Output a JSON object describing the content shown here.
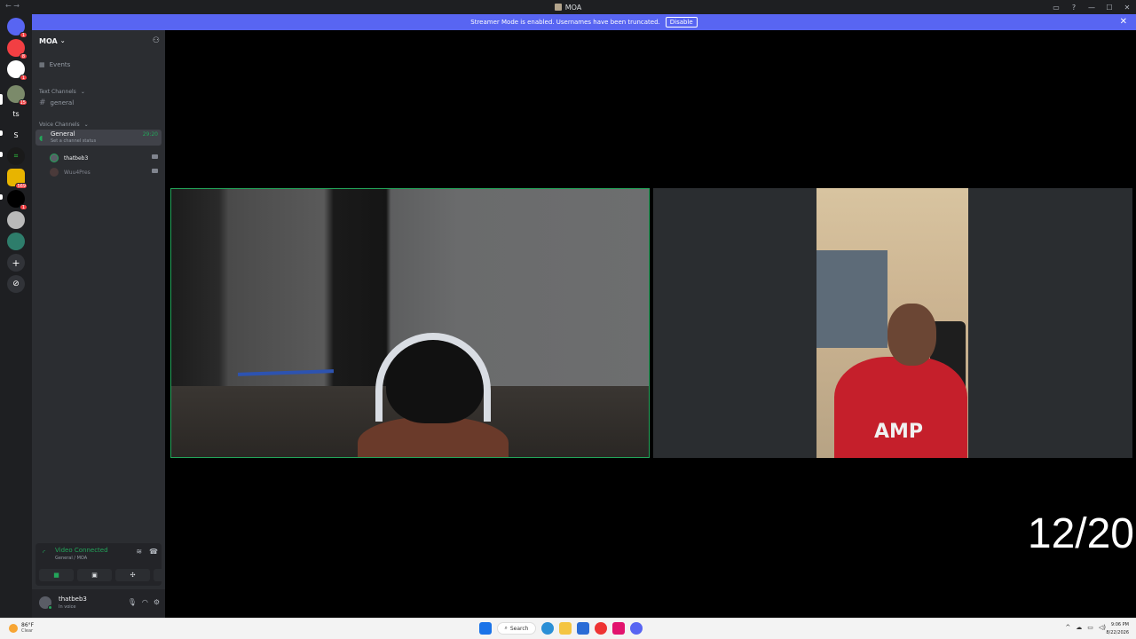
{
  "window": {
    "title": "MOA",
    "nav_arrows": "← →",
    "controls": [
      "▭",
      "?",
      "—",
      "☐",
      "✕"
    ]
  },
  "banner": {
    "message": "Streamer Mode is enabled. Usernames have been truncated.",
    "disable_label": "Disable",
    "close_icon": "✕"
  },
  "guilds": [
    {
      "label": "",
      "color": "#5865f2",
      "icon": "discord-home-icon",
      "badge": "1"
    },
    {
      "label": "",
      "color": "#f23f43",
      "icon": "server-icon",
      "badge": "8"
    },
    {
      "label": "",
      "color": "#ffffff",
      "icon": "server-icon",
      "badge": "1"
    },
    {
      "label": "",
      "color": "#7b8a6a",
      "icon": "server-icon",
      "badge": "15"
    },
    {
      "label": "ts",
      "color": "#1e1f22",
      "icon": "text-server-icon",
      "badge": ""
    },
    {
      "label": "S",
      "color": "#1e1f22",
      "icon": "text-server-icon",
      "badge": ""
    },
    {
      "label": "",
      "color": "#1a1a1a",
      "icon": "server-icon",
      "badge": ""
    },
    {
      "label": "",
      "color": "#e8b400",
      "icon": "server-icon",
      "badge": "569"
    },
    {
      "label": "",
      "color": "#000000",
      "icon": "server-icon",
      "badge": "1"
    },
    {
      "label": "",
      "color": "#b9b9b9",
      "icon": "server-icon",
      "badge": ""
    },
    {
      "label": "",
      "color": "#2e7d6b",
      "icon": "server-icon",
      "badge": ""
    },
    {
      "label": "+",
      "color": "#313338",
      "icon": "add-server-icon",
      "badge": ""
    },
    {
      "label": "⊘",
      "color": "#313338",
      "icon": "explore-icon",
      "badge": ""
    }
  ],
  "sidebar": {
    "server_name": "MOA",
    "server_chevron": "⌄",
    "events_label": "Events",
    "text_category": "Text Channels",
    "text_channels": [
      "general"
    ],
    "voice_category": "Voice Channels",
    "voice_channel": {
      "name": "General",
      "status_prompt": "Set a channel status",
      "timer": "29:20"
    },
    "members": [
      {
        "name": "thatbeb3",
        "active": true
      },
      {
        "name": "Wuu4Pres",
        "active": false
      }
    ]
  },
  "voice_panel": {
    "status": "Video Connected",
    "channel": "General / MOA"
  },
  "user_panel": {
    "username": "thatbeb3",
    "status": "In voice"
  },
  "stage": {
    "counter": "12/20",
    "right_shirt_text": "AMP"
  },
  "taskbar": {
    "temperature": "86°F",
    "condition": "Clear",
    "search_label": "Search",
    "time": "9:06 PM",
    "date": "8/22/2026"
  },
  "colors": {
    "brand": "#5865f2",
    "connected": "#23a55a",
    "danger": "#f23f43"
  }
}
